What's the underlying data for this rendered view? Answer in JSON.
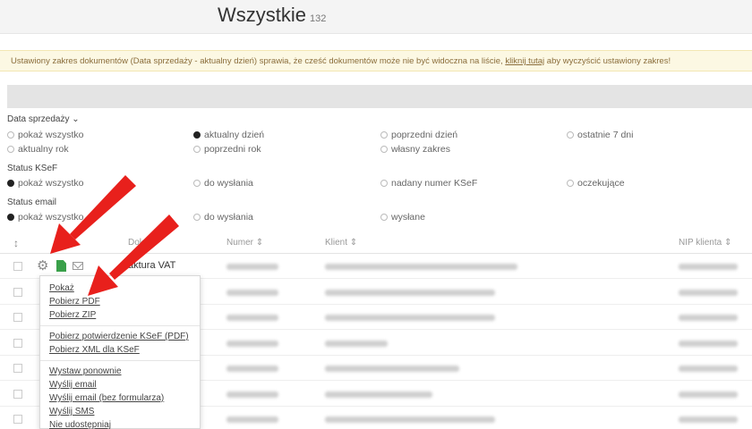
{
  "header": {
    "title": "Wszystkie",
    "count": "132"
  },
  "alert": {
    "text_before": "Ustawiony zakres dokumentów (Data sprzedaży - aktualny dzień) sprawia, że cześć dokumentów może nie być widoczna na liście, ",
    "link": "kliknij tutaj",
    "text_after": " aby wyczyścić ustawiony zakres!"
  },
  "filters": {
    "date": {
      "title": "Data sprzedaży",
      "options": [
        "pokaż wszystko",
        "aktualny dzień",
        "poprzedni dzień",
        "ostatnie 7 dni",
        "aktualny rok",
        "poprzedni rok",
        "własny zakres"
      ],
      "selected": "aktualny dzień"
    },
    "ksef": {
      "title": "Status KSeF",
      "options": [
        "pokaż wszystko",
        "do wysłania",
        "nadany numer KSeF",
        "oczekujące"
      ],
      "selected": "pokaż wszystko"
    },
    "email": {
      "title": "Status email",
      "options": [
        "pokaż wszystko",
        "do wysłania",
        "wysłane"
      ],
      "selected": "pokaż wszystko"
    }
  },
  "table": {
    "headers": {
      "type": "Dok",
      "number": "Numer",
      "client": "Klient",
      "nip": "NIP klienta"
    },
    "first_row_type": "aktura VAT"
  },
  "dropdown": {
    "groups": [
      [
        "Pokaż",
        "Pobierz PDF",
        "Pobierz ZIP"
      ],
      [
        "Pobierz potwierdzenie KSeF (PDF)",
        "Pobierz XML dla KSeF"
      ],
      [
        "Wystaw ponownie",
        "Wyślij email",
        "Wyślij email (bez formularza)",
        "Wyślij SMS",
        "Nie udostępniaj"
      ]
    ]
  },
  "colors": {
    "alert_bg": "#fcf8e3",
    "alert_text": "#8a6d3b",
    "doc_icon": "#3aa04a",
    "annotation_arrow": "#e8201c"
  }
}
